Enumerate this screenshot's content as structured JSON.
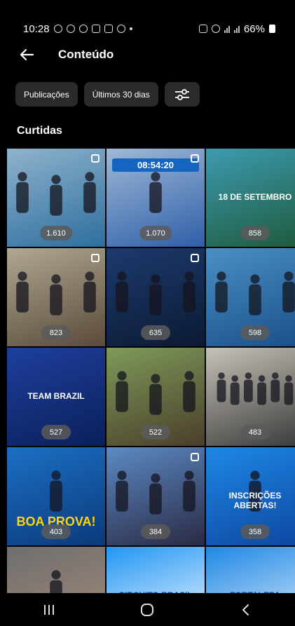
{
  "status_bar": {
    "time": "10:28",
    "battery": "66%"
  },
  "header": {
    "title": "Conteúdo"
  },
  "filters": {
    "type_label": "Publicações",
    "period_label": "Últimos 30 dias",
    "settings_icon": "sliders-icon"
  },
  "section_title": "Curtidas",
  "posts": [
    {
      "count": "1.610",
      "scene": "swimmers-podium",
      "colors": [
        "#8fb3cc",
        "#2d6e9e"
      ]
    },
    {
      "count": "1.070",
      "scene": "finish-clock",
      "clock": "08:54:20",
      "colors": [
        "#9fb9d6",
        "#2f5fa8"
      ]
    },
    {
      "count": "858",
      "scene": "map-promo",
      "promo": "18 DE SETEMBRO",
      "colors": [
        "#3d9bb0",
        "#1e5a3c"
      ]
    },
    {
      "count": "823",
      "scene": "cyclists-arc",
      "colors": [
        "#b0a892",
        "#5a4a3a"
      ]
    },
    {
      "count": "635",
      "scene": "runners-dark",
      "colors": [
        "#1d3a6e",
        "#0b1a33"
      ]
    },
    {
      "count": "598",
      "scene": "podium-numbers",
      "colors": [
        "#4a90c4",
        "#1a4f8a"
      ]
    },
    {
      "count": "527",
      "scene": "team-brazil",
      "promo": "TEAM BRAZIL",
      "colors": [
        "#1e3f9c",
        "#0b1f5a"
      ]
    },
    {
      "count": "522",
      "scene": "bike-park",
      "colors": [
        "#7e9a5a",
        "#4a3e2a"
      ]
    },
    {
      "count": "483",
      "scene": "group-photo",
      "colors": [
        "#c7c2b8",
        "#3a3a3a"
      ]
    },
    {
      "count": "403",
      "scene": "boa-prova",
      "promo": "BOA PROVA!",
      "colors": [
        "#1c6fc4",
        "#0b3a7a"
      ]
    },
    {
      "count": "384",
      "scene": "medals",
      "colors": [
        "#5c8ac4",
        "#2a2a44"
      ]
    },
    {
      "count": "358",
      "scene": "inscricoes",
      "promo": "INSCRIÇÕES ABERTAS!",
      "colors": [
        "#1e88e5",
        "#0d47a1"
      ]
    },
    {
      "count": "",
      "scene": "portrait",
      "colors": [
        "#6e6e6e",
        "#a88c7a"
      ]
    },
    {
      "count": "",
      "scene": "circuito-sprint",
      "promo": "CIRCUITO BRASIL",
      "colors": [
        "#2196f3",
        "#ffffff"
      ]
    },
    {
      "count": "",
      "scene": "circuito-fortaleza",
      "promo": "FORTALEZA",
      "colors": [
        "#1e88e5",
        "#e8f1fb"
      ]
    }
  ],
  "nav": {
    "recents_icon": "recent-apps-icon",
    "home_icon": "home-icon",
    "back_icon": "back-icon"
  }
}
